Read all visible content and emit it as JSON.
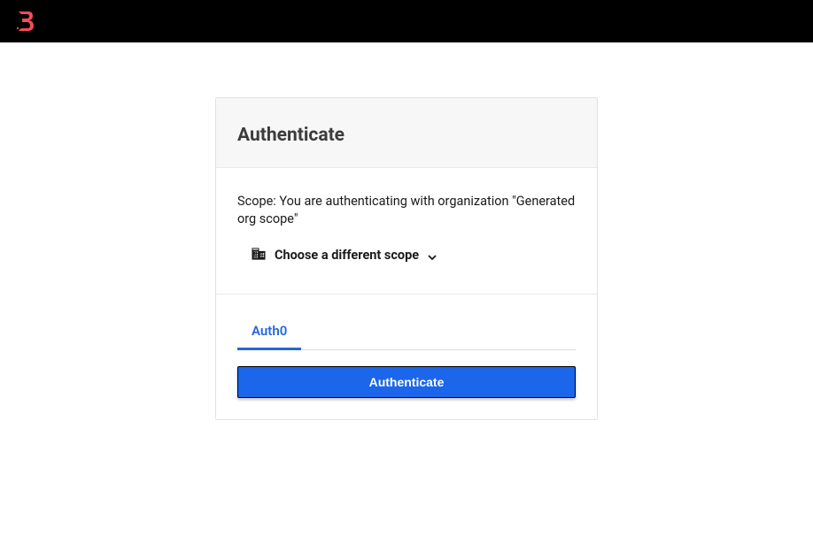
{
  "card": {
    "title": "Authenticate",
    "scope_text": "Scope: You are authenticating with organization \"Generated org scope\"",
    "choose_scope_label": "Choose a different scope"
  },
  "tabs": [
    {
      "label": "Auth0"
    }
  ],
  "button": {
    "authenticate": "Authenticate"
  },
  "colors": {
    "logo": "#f94a56",
    "primary": "#1b66ea",
    "tab_active": "#2466e0"
  }
}
